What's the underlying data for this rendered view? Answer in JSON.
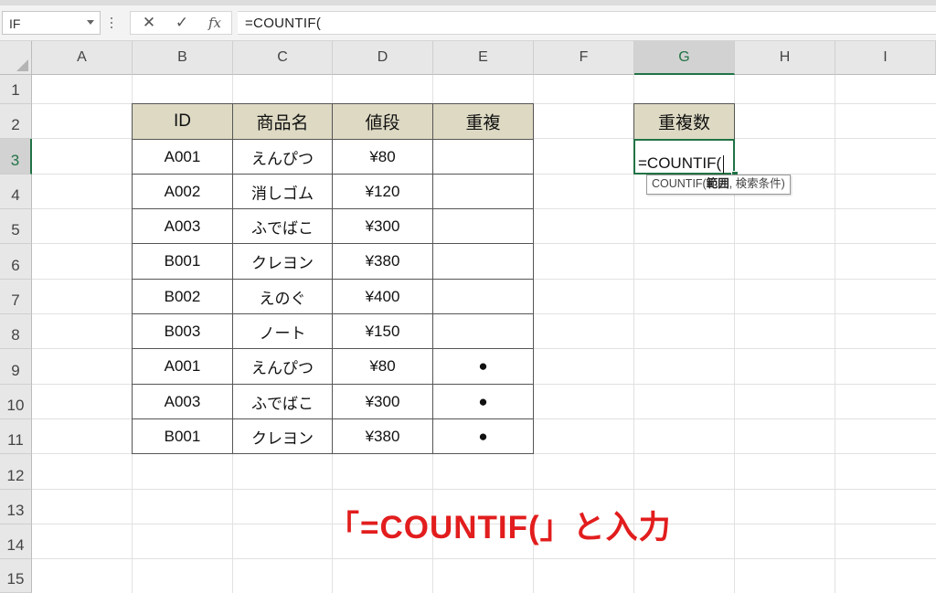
{
  "formula_bar": {
    "name_box": "IF",
    "cancel_icon": "✕",
    "enter_icon": "✓",
    "function_label": "fx",
    "formula": "=COUNTIF("
  },
  "columns": [
    "A",
    "B",
    "C",
    "D",
    "E",
    "F",
    "G",
    "H",
    "I"
  ],
  "selected_column": "G",
  "rows": [
    "1",
    "2",
    "3",
    "4",
    "5",
    "6",
    "7",
    "8",
    "9",
    "10",
    "11",
    "12",
    "13",
    "14",
    "15"
  ],
  "selected_row": "3",
  "table": {
    "headers": [
      "ID",
      "商品名",
      "値段",
      "重複"
    ],
    "rows": [
      [
        "A001",
        "えんぴつ",
        "¥80",
        ""
      ],
      [
        "A002",
        "消しゴム",
        "¥120",
        ""
      ],
      [
        "A003",
        "ふでばこ",
        "¥300",
        ""
      ],
      [
        "B001",
        "クレヨン",
        "¥380",
        ""
      ],
      [
        "B002",
        "えのぐ",
        "¥400",
        ""
      ],
      [
        "B003",
        "ノート",
        "¥150",
        ""
      ],
      [
        "A001",
        "えんぴつ",
        "¥80",
        "●"
      ],
      [
        "A003",
        "ふでばこ",
        "¥300",
        "●"
      ],
      [
        "B001",
        "クレヨン",
        "¥380",
        "●"
      ]
    ]
  },
  "result_header": "重複数",
  "active_cell": {
    "address": "G3",
    "content": "=COUNTIF("
  },
  "tooltip": {
    "func": "COUNTIF(",
    "arg1": "範囲",
    "rest": ", 検索条件)"
  },
  "annotation": "「=COUNTIF(」と入力",
  "colors": {
    "accent": "#217346",
    "header_fill": "#ddd9c3",
    "annotation": "#e21d1d"
  }
}
